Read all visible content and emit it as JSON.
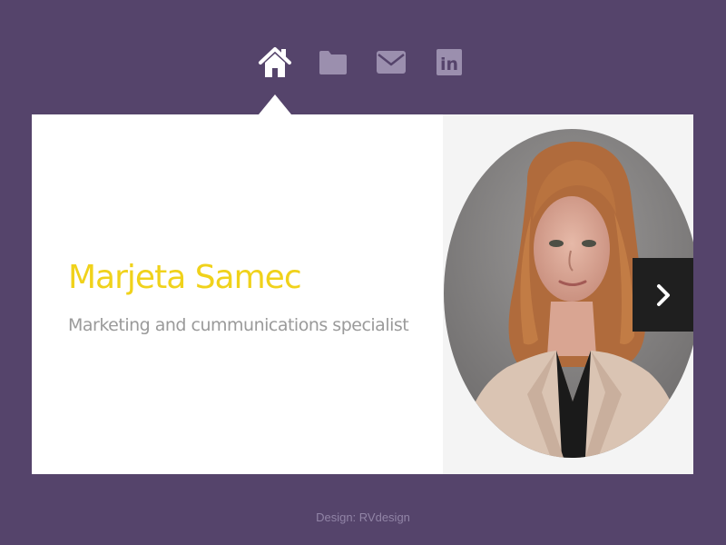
{
  "nav": {
    "items": [
      {
        "icon": "home-icon",
        "label": "Home",
        "active": true
      },
      {
        "icon": "folder-icon",
        "label": "Portfolio",
        "active": false
      },
      {
        "icon": "mail-icon",
        "label": "Contact",
        "active": false
      },
      {
        "icon": "linkedin-icon",
        "label": "LinkedIn",
        "active": false
      }
    ],
    "linkedin_glyph": "in"
  },
  "profile": {
    "name": "Marjeta Samec",
    "title": "Marketing and cummunications specialist"
  },
  "slider": {
    "next_icon": "chevron-right-icon"
  },
  "footer": {
    "credit": "Design: RVdesign"
  },
  "colors": {
    "background": "#55446b",
    "accent_name": "#f0d21b",
    "subtitle": "#9a9a9a",
    "nav_active": "#ffffff",
    "nav_inactive": "#9b8fae",
    "next_button": "#1f1f1f"
  }
}
